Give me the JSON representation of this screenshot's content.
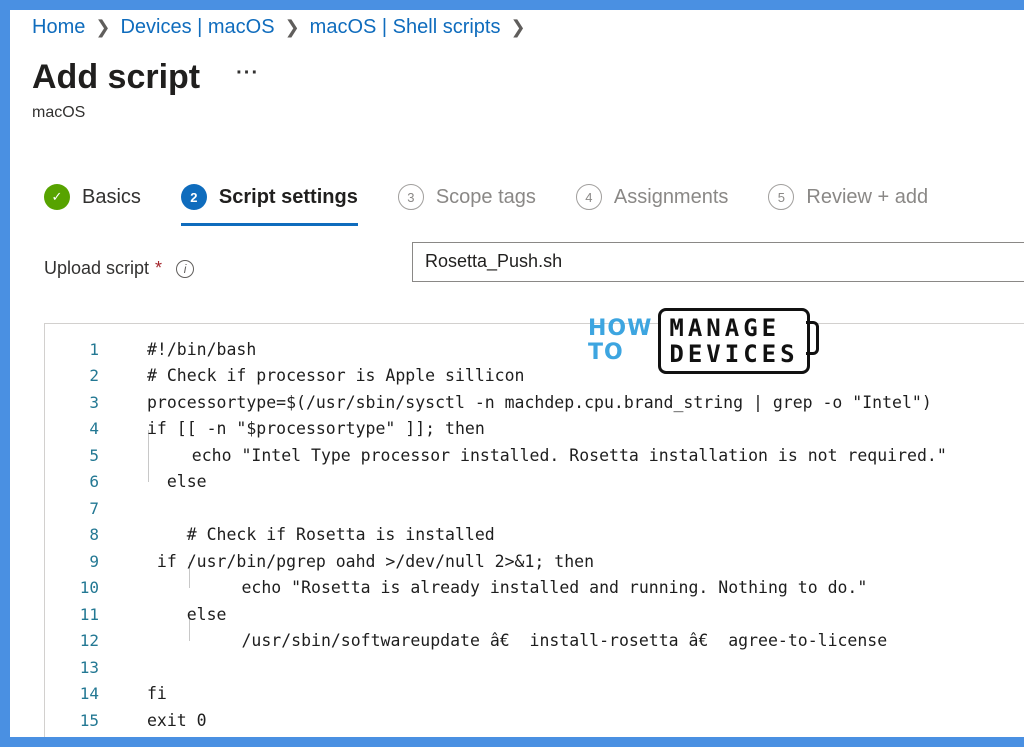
{
  "breadcrumb": [
    "Home",
    "Devices | macOS",
    "macOS | Shell scripts"
  ],
  "page": {
    "title": "Add script",
    "more": "···",
    "subtitle": "macOS"
  },
  "steps": [
    {
      "num": "✓",
      "label": "Basics",
      "state": "done"
    },
    {
      "num": "2",
      "label": "Script settings",
      "state": "active"
    },
    {
      "num": "3",
      "label": "Scope tags",
      "state": "todo"
    },
    {
      "num": "4",
      "label": "Assignments",
      "state": "todo"
    },
    {
      "num": "5",
      "label": "Review + add",
      "state": "todo"
    }
  ],
  "upload": {
    "label": "Upload script",
    "required": "*",
    "info": "i",
    "file_name": "Rosetta_Push.sh"
  },
  "watermark": {
    "line1": "HOW",
    "line2": "TO",
    "box1": "MANAGE",
    "box2": "DEVICES"
  },
  "editor": {
    "lines": [
      {
        "n": "1",
        "code": "#!/bin/bash"
      },
      {
        "n": "2",
        "code": "# Check if processor is Apple sillicon"
      },
      {
        "n": "3",
        "code": "processortype=$(/usr/sbin/sysctl -n machdep.cpu.brand_string | grep -o \"Intel\")"
      },
      {
        "n": "4",
        "code": "if [[ -n \"$processortype\" ]]; then"
      },
      {
        "n": "5",
        "code": "   echo \"Intel Type processor installed. Rosetta installation is not required.\""
      },
      {
        "n": "6",
        "code": "  else"
      },
      {
        "n": "7",
        "code": ""
      },
      {
        "n": "8",
        "code": "    # Check if Rosetta is installed"
      },
      {
        "n": "9",
        "code": " if /usr/bin/pgrep oahd >/dev/null 2>&1; then"
      },
      {
        "n": "10",
        "code": "        echo \"Rosetta is already installed and running. Nothing to do.\""
      },
      {
        "n": "11",
        "code": "    else"
      },
      {
        "n": "12",
        "code": "        /usr/sbin/softwareupdate â€  install-rosetta â€  agree-to-license"
      },
      {
        "n": "13",
        "code": ""
      },
      {
        "n": "14",
        "code": "fi"
      },
      {
        "n": "15",
        "code": "exit 0"
      }
    ]
  }
}
